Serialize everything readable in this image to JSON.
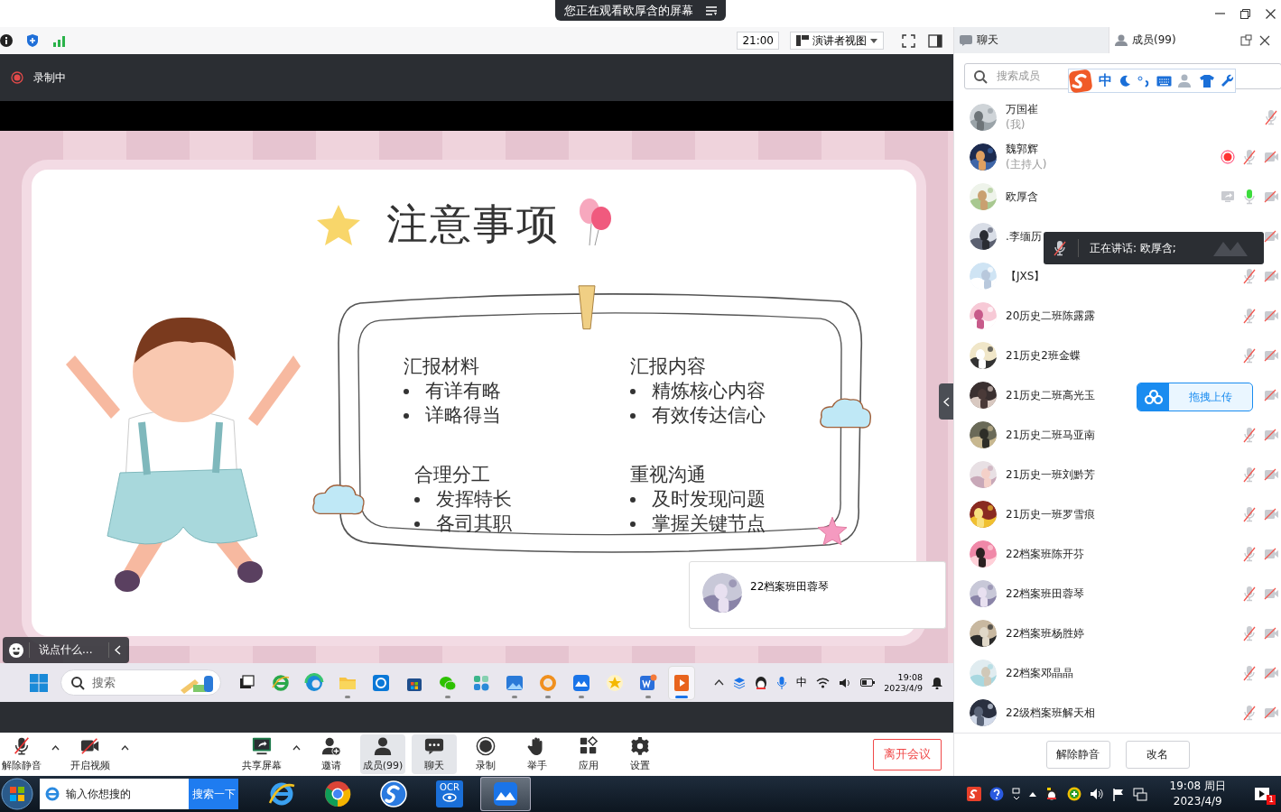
{
  "title_bar": {
    "banner": "您正在观看欧厚含的屏幕"
  },
  "toolbar": {
    "time": "21:00",
    "view_mode": "演讲者视图"
  },
  "panel_tabs": [
    {
      "label": "聊天",
      "selected": false
    },
    {
      "label": "成员(99)",
      "selected": true
    }
  ],
  "recording": {
    "label": "录制中",
    "active": true
  },
  "slide": {
    "title": "注意事项",
    "sections": [
      {
        "heading": "汇报材料",
        "bullets": [
          "有详有略",
          "详略得当"
        ]
      },
      {
        "heading": "汇报内容",
        "bullets": [
          "精炼核心内容",
          "有效传达信心"
        ]
      },
      {
        "heading": "合理分工",
        "bullets": [
          "发挥特长",
          "各司其职"
        ]
      },
      {
        "heading": "重视沟通",
        "bullets": [
          "及时发现问题",
          "掌握关键节点"
        ]
      }
    ]
  },
  "chat_input": {
    "placeholder": "说点什么..."
  },
  "speaker_card": {
    "name": "22档案班田蓉琴"
  },
  "shared_taskbar": {
    "search_placeholder": "搜索",
    "ime": "中",
    "time": "19:08",
    "date": "2023/4/9",
    "apps": [
      {
        "kind": "taskview",
        "running": false,
        "selected": false
      },
      {
        "kind": "ie",
        "running": false,
        "selected": false
      },
      {
        "kind": "edge",
        "running": false,
        "selected": false
      },
      {
        "kind": "folder",
        "running": true,
        "selected": false
      },
      {
        "kind": "cortana",
        "running": false,
        "selected": false
      },
      {
        "kind": "store",
        "running": false,
        "selected": false
      },
      {
        "kind": "wechat",
        "running": true,
        "selected": false
      },
      {
        "kind": "puzzle",
        "running": false,
        "selected": false
      },
      {
        "kind": "photos",
        "running": true,
        "selected": false
      },
      {
        "kind": "ring",
        "running": true,
        "selected": false
      },
      {
        "kind": "meeting",
        "running": true,
        "selected": false
      },
      {
        "kind": "star",
        "running": false,
        "selected": false
      },
      {
        "kind": "wps",
        "running": true,
        "selected": false
      },
      {
        "kind": "media",
        "running": true,
        "selected": true
      }
    ]
  },
  "meeting_bar": {
    "buttons": [
      {
        "kind": "mic_off",
        "label": "解除静音",
        "menu": true,
        "selected": false
      },
      {
        "kind": "video_off",
        "label": "开启视频",
        "menu": true,
        "selected": false
      },
      {
        "kind": "share",
        "label": "共享屏幕",
        "menu": true,
        "selected": false
      },
      {
        "kind": "invite",
        "label": "邀请",
        "menu": false,
        "selected": false
      },
      {
        "kind": "members",
        "label": "成员(99)",
        "menu": false,
        "selected": true
      },
      {
        "kind": "chat",
        "label": "聊天",
        "menu": false,
        "selected": true
      },
      {
        "kind": "record",
        "label": "录制",
        "menu": false,
        "selected": false
      },
      {
        "kind": "hand",
        "label": "举手",
        "menu": false,
        "selected": false
      },
      {
        "kind": "apps",
        "label": "应用",
        "menu": false,
        "selected": false
      },
      {
        "kind": "settings",
        "label": "设置",
        "menu": false,
        "selected": false
      }
    ],
    "leave": "离开会议"
  },
  "members": {
    "search_placeholder": "搜索成员",
    "list": [
      {
        "name": "万国崔",
        "note": "(我)",
        "mic_muted": true
      },
      {
        "name": "魏郭辉",
        "note": "(主持人)",
        "recording": true,
        "mic_muted": true,
        "camera_off": true
      },
      {
        "name": "欧厚含",
        "sharing": true,
        "mic_muted": false,
        "camera_off": true
      },
      {
        "name": ".李缅历",
        "camera_off": true
      },
      {
        "name": "【JXS】",
        "mic_muted": true,
        "camera_off": true
      },
      {
        "name": "20历史二班陈露露",
        "mic_muted": true,
        "camera_off": true
      },
      {
        "name": "21历史2班金蝶",
        "mic_muted": true,
        "camera_off": true
      },
      {
        "name": "21历史二班高光玉",
        "camera_off": true
      },
      {
        "name": "21历史二班马亚南",
        "mic_muted": true,
        "camera_off": true
      },
      {
        "name": "21历史一班刘黔芳",
        "mic_muted": true,
        "camera_off": true
      },
      {
        "name": "21历史一班罗雪痕",
        "mic_muted": true,
        "camera_off": true
      },
      {
        "name": "22档案班陈开芬",
        "mic_muted": true,
        "camera_off": true
      },
      {
        "name": "22档案班田蓉琴",
        "mic_muted": true,
        "camera_off": true
      },
      {
        "name": "22档案班杨胜婷",
        "mic_muted": true,
        "camera_off": true
      },
      {
        "name": "22档案邓晶晶",
        "mic_muted": true,
        "camera_off": true
      },
      {
        "name": "22级档案班解天相",
        "mic_muted": true,
        "camera_off": true
      }
    ],
    "actions": [
      "解除静音",
      "改名"
    ]
  },
  "ime_toolbar": {
    "mode": "中"
  },
  "speaking_tooltip": "正在讲话: 欧厚含;",
  "upload_button": "拖拽上传",
  "taskbar": {
    "search_placeholder": "输入你想搜的",
    "search_button": "搜索一下",
    "apps": [
      {
        "kind": "ie",
        "selected": false
      },
      {
        "kind": "chrome",
        "selected": false
      },
      {
        "kind": "sogou",
        "selected": false
      },
      {
        "kind": "ocr",
        "label": "OCR",
        "selected": false
      },
      {
        "kind": "meeting",
        "selected": true
      }
    ],
    "time": "19:08 周日",
    "date": "2023/4/9",
    "notifications": "1"
  }
}
